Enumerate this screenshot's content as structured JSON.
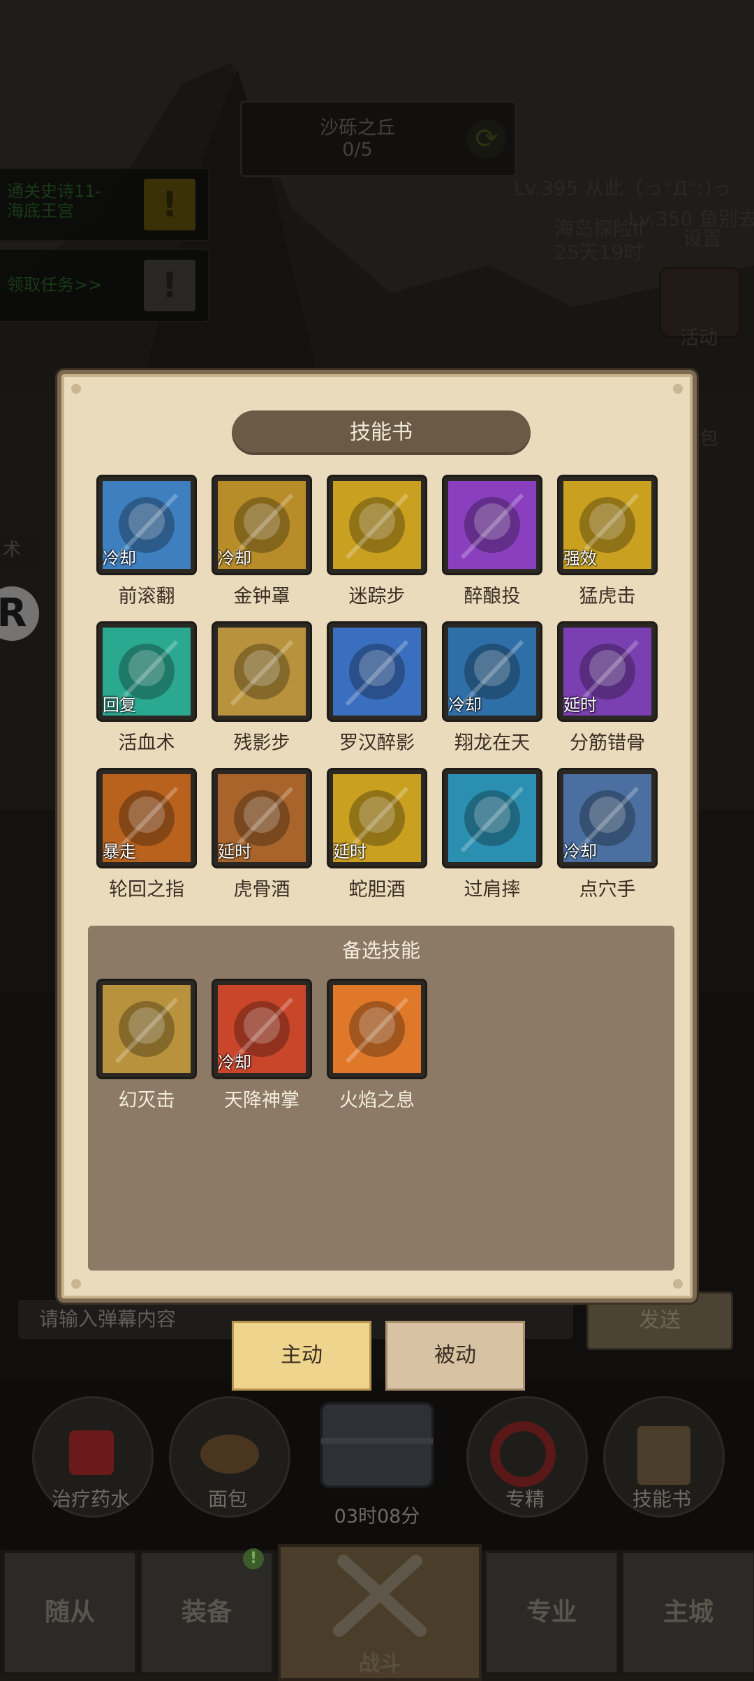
{
  "stage": {
    "name": "沙砾之丘",
    "progress": "0/5"
  },
  "quests": [
    {
      "text_line1": "通关史诗11-",
      "text_line2": "海底王宫"
    },
    {
      "text_line1": "领取任务>>",
      "text_line2": ""
    }
  ],
  "right_info": {
    "line1": "Lv.395 从此（っ°Д°;)っ",
    "line2": "海岛探险II",
    "line2b": "Lv.350 鱼别去",
    "line3": "25天19时",
    "settings": "设置",
    "activity": "活动",
    "bag": "包"
  },
  "left_tab": "术",
  "left_badge": "R",
  "panel": {
    "title": "技能书",
    "skills": [
      {
        "name": "前滚翻",
        "tag": "冷却",
        "icon": "roll-icon",
        "color": "#3d7fbf"
      },
      {
        "name": "金钟罩",
        "tag": "冷却",
        "icon": "golden-bell-icon",
        "color": "#b88c28"
      },
      {
        "name": "迷踪步",
        "tag": "",
        "icon": "shadow-step-icon",
        "color": "#c9a020"
      },
      {
        "name": "醉酿投",
        "tag": "",
        "icon": "barrel-throw-icon",
        "color": "#8a3fbf"
      },
      {
        "name": "猛虎击",
        "tag": "强效",
        "icon": "tiger-fist-icon",
        "color": "#c9a020"
      },
      {
        "name": "活血术",
        "tag": "回复",
        "icon": "healing-hand-icon",
        "color": "#2aa890"
      },
      {
        "name": "残影步",
        "tag": "",
        "icon": "afterimage-icon",
        "color": "#b8923c"
      },
      {
        "name": "罗汉醉影",
        "tag": "",
        "icon": "drunk-panda-icon",
        "color": "#3a6fbf"
      },
      {
        "name": "翔龙在天",
        "tag": "冷却",
        "icon": "dragon-icon",
        "color": "#2f6fa8"
      },
      {
        "name": "分筋错骨",
        "tag": "延时",
        "icon": "bone-break-icon",
        "color": "#7a3fb0"
      },
      {
        "name": "轮回之指",
        "tag": "暴走",
        "icon": "reincarnation-finger-icon",
        "color": "#b8621e"
      },
      {
        "name": "虎骨酒",
        "tag": "延时",
        "icon": "tiger-wine-icon",
        "color": "#a8642a"
      },
      {
        "name": "蛇胆酒",
        "tag": "延时",
        "icon": "snake-wine-icon",
        "color": "#c9a020"
      },
      {
        "name": "过肩摔",
        "tag": "",
        "icon": "shoulder-throw-icon",
        "color": "#2a8fb0"
      },
      {
        "name": "点穴手",
        "tag": "冷却",
        "icon": "pressure-point-icon",
        "color": "#4a6fa0"
      }
    ],
    "alt_title": "备选技能",
    "alt_skills": [
      {
        "name": "幻灭击",
        "tag": "",
        "icon": "disillusion-strike-icon",
        "color": "#b8923c"
      },
      {
        "name": "天降神掌",
        "tag": "冷却",
        "icon": "heavenly-palm-icon",
        "color": "#c9462a"
      },
      {
        "name": "火焰之息",
        "tag": "",
        "icon": "flame-breath-icon",
        "color": "#e0782a"
      }
    ]
  },
  "chat": {
    "placeholder": "请输入弹幕内容",
    "send": "发送"
  },
  "tabs": {
    "active": "主动",
    "passive": "被动"
  },
  "items": [
    {
      "label": "治疗药水",
      "icon": "potion-icon"
    },
    {
      "label": "面包",
      "icon": "bread-icon"
    },
    {
      "label": "专精",
      "icon": "specialization-icon"
    },
    {
      "label": "技能书",
      "icon": "skill-book-icon"
    }
  ],
  "chest_timer": "03时08分",
  "nav": {
    "followers": "随从",
    "equipment": "装备",
    "battle": "战斗",
    "profession": "专业",
    "main_city": "主城",
    "notice": "!"
  },
  "colors": {
    "panel_bg": "#eadbbd",
    "panel_border": "#7c6a52",
    "title_pill": "#6b5b46",
    "tab_active": "#efd48d",
    "tab_inactive": "#d7c2a3"
  }
}
